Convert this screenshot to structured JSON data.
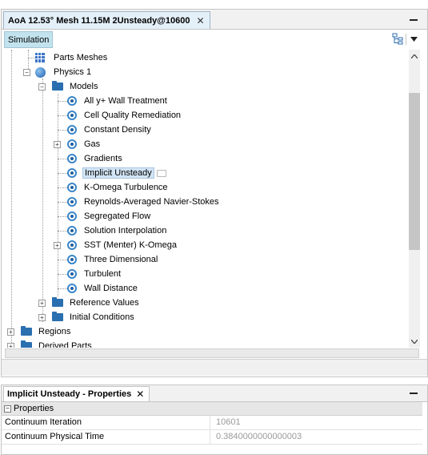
{
  "top_tab": {
    "title": "AoA 12.53° Mesh 11.15M 2Unsteady@10600",
    "close": "✕"
  },
  "subtab": {
    "label": "Simulation"
  },
  "tree": {
    "parts_meshes": "Parts Meshes",
    "physics": "Physics 1",
    "models_folder": "Models",
    "models": [
      "All y+ Wall Treatment",
      "Cell Quality Remediation",
      "Constant Density",
      "Gas",
      "Gradients",
      "Implicit Unsteady",
      "K-Omega Turbulence",
      "Reynolds-Averaged Navier-Stokes",
      "Segregated Flow",
      "Solution Interpolation",
      "SST (Menter) K-Omega",
      "Three Dimensional",
      "Turbulent",
      "Wall Distance"
    ],
    "reference_values": "Reference Values",
    "initial_conditions": "Initial Conditions",
    "regions": "Regions",
    "derived_parts": "Derived Parts"
  },
  "properties_panel": {
    "title": "Implicit Unsteady - Properties",
    "close": "✕",
    "section": "Properties",
    "rows": [
      {
        "name": "Continuum Iteration",
        "value": "10601"
      },
      {
        "name": "Continuum Physical Time",
        "value": "0.3840000000000003"
      }
    ]
  }
}
